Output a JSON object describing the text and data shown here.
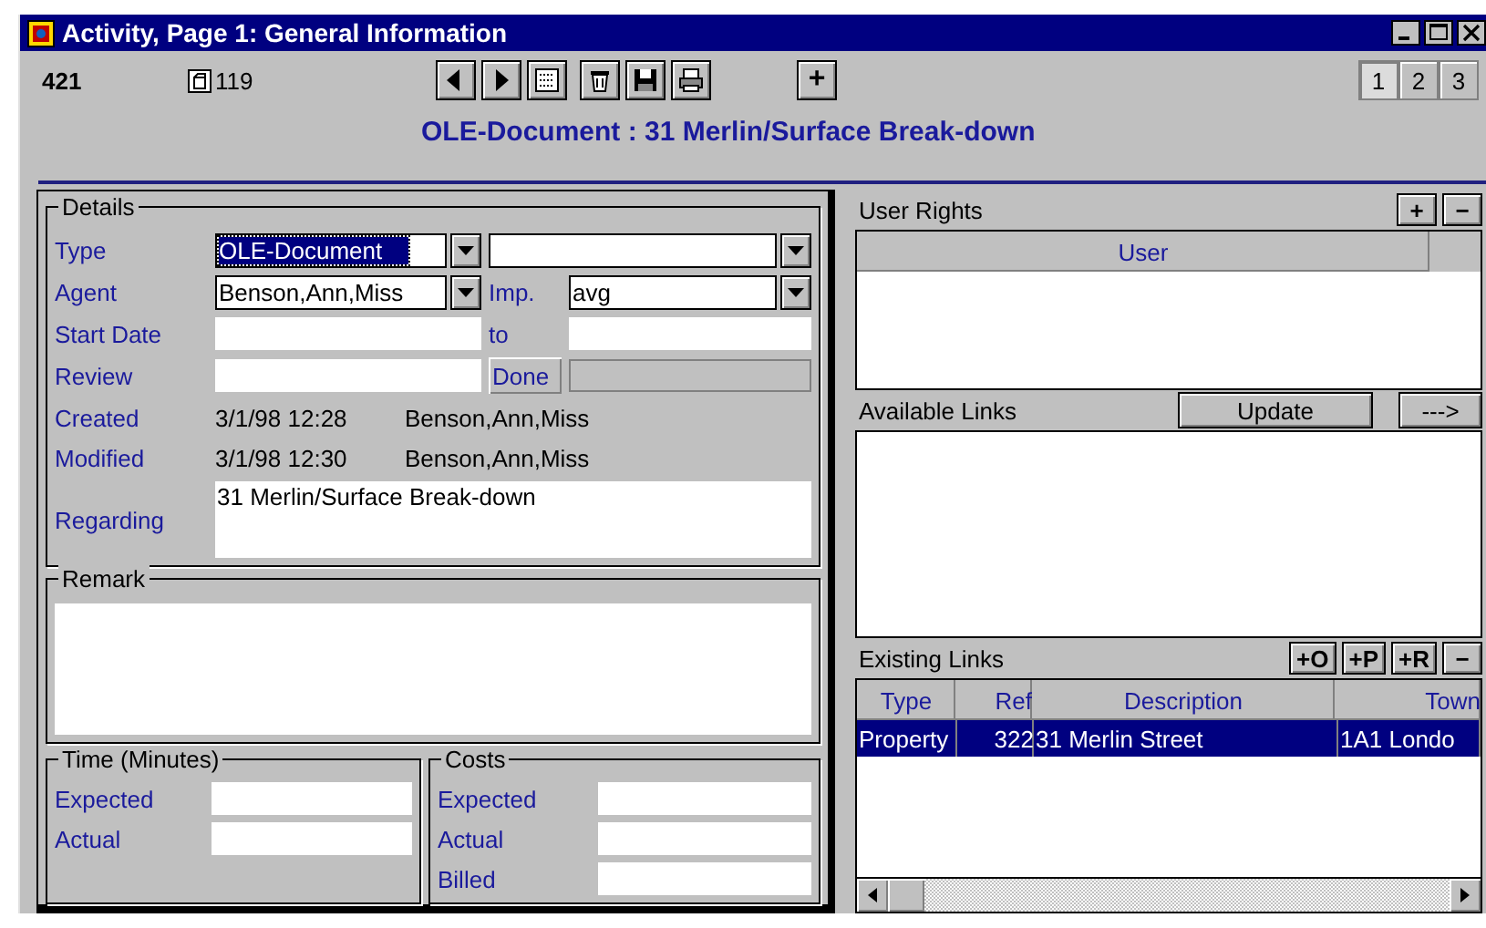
{
  "window": {
    "title": "Activity, Page 1: General Information"
  },
  "header": {
    "record_number": "421",
    "attachment_count": "119",
    "add_button": "+",
    "subtitle": "OLE-Document : 31 Merlin/Surface Break-down",
    "toolbar": [
      {
        "kind": "prev"
      },
      {
        "kind": "next"
      },
      {
        "kind": "form"
      },
      {
        "kind": "delete"
      },
      {
        "kind": "save"
      },
      {
        "kind": "print"
      }
    ],
    "pages": [
      {
        "label": "1",
        "selected": true
      },
      {
        "label": "2",
        "selected": false
      },
      {
        "label": "3",
        "selected": false
      }
    ]
  },
  "details": {
    "legend": "Details",
    "type": {
      "label": "Type",
      "value": "OLE-Document",
      "text_selected": true
    },
    "agent": {
      "label": "Agent",
      "value": "Benson,Ann,Miss"
    },
    "importance": {
      "label": "Imp.",
      "value": "avg"
    },
    "start_date": {
      "label": "Start Date"
    },
    "to": {
      "label": "to"
    },
    "review": {
      "label": "Review"
    },
    "done_button": "Done",
    "created": {
      "label": "Created",
      "date": "3/1/98 12:28",
      "user": "Benson,Ann,Miss"
    },
    "modified": {
      "label": "Modified",
      "date": "3/1/98 12:30",
      "user": "Benson,Ann,Miss"
    },
    "regarding": {
      "label": "Regarding",
      "value": "31 Merlin/Surface Break-down"
    }
  },
  "remark": {
    "legend": "Remark"
  },
  "time": {
    "legend": "Time (Minutes)",
    "rows": [
      {
        "label": "Expected"
      },
      {
        "label": "Actual"
      }
    ]
  },
  "costs": {
    "legend": "Costs",
    "rows": [
      {
        "label": "Expected"
      },
      {
        "label": "Actual"
      },
      {
        "label": "Billed"
      }
    ]
  },
  "user_rights": {
    "title": "User Rights",
    "buttons": [
      "+",
      "−"
    ],
    "columns": [
      "User"
    ]
  },
  "available_links": {
    "title": "Available Links",
    "update_button": "Update",
    "arrow_button": "--->"
  },
  "existing_links": {
    "title": "Existing Links",
    "buttons": [
      "+O",
      "+P",
      "+R",
      "−"
    ],
    "columns": [
      "Type",
      "Ref",
      "Description",
      "Town"
    ],
    "rows": [
      {
        "cells": [
          "Property",
          "322",
          "31 Merlin Street",
          "1A1 Londo"
        ],
        "selected": true
      }
    ]
  }
}
